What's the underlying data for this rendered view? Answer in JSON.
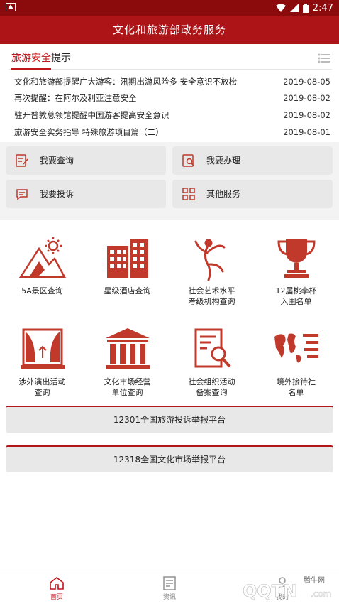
{
  "status_bar": {
    "time": "2:47"
  },
  "app": {
    "title": "文化和旅游部政务服务"
  },
  "notice": {
    "title_red": "旅游安全",
    "title_rest": "提示",
    "items": [
      {
        "title": "文化和旅游部提醒广大游客：汛期出游风险多 安全意识不放松",
        "date": "2019-08-05"
      },
      {
        "title": "再次提醒：在阿尔及利亚注意安全",
        "date": "2019-08-02"
      },
      {
        "title": "驻开普敦总领馆提醒中国游客提高安全意识",
        "date": "2019-08-02"
      },
      {
        "title": "旅游安全实务指导 特殊旅游项目篇（二）",
        "date": "2019-08-01"
      }
    ]
  },
  "quick_actions": [
    {
      "label": "我要查询"
    },
    {
      "label": "我要办理"
    },
    {
      "label": "我要投诉"
    },
    {
      "label": "其他服务"
    }
  ],
  "services": [
    {
      "line1": "5A景区查询",
      "line2": ""
    },
    {
      "line1": "星级酒店查询",
      "line2": ""
    },
    {
      "line1": "社会艺术水平",
      "line2": "考级机构查询"
    },
    {
      "line1": "12届桃李杯",
      "line2": "入围名单"
    },
    {
      "line1": "涉外演出活动",
      "line2": "查询"
    },
    {
      "line1": "文化市场经营",
      "line2": "单位查询"
    },
    {
      "line1": "社会组织活动",
      "line2": "备案查询"
    },
    {
      "line1": "境外接待社",
      "line2": "名单"
    }
  ],
  "platforms": [
    {
      "label": "12301全国旅游投诉举报平台"
    },
    {
      "label": "12318全国文化市场举报平台"
    }
  ],
  "tabs": [
    {
      "label": "首页"
    },
    {
      "label": "资讯"
    },
    {
      "label": "我的"
    }
  ],
  "watermark": {
    "brand": "QQTN",
    "sub": "腾牛网",
    "domain": ".com"
  },
  "colors": {
    "primary": "#ad1418",
    "status": "#8b0a0c",
    "accent": "#c0141b",
    "icon": "#c0392b"
  }
}
